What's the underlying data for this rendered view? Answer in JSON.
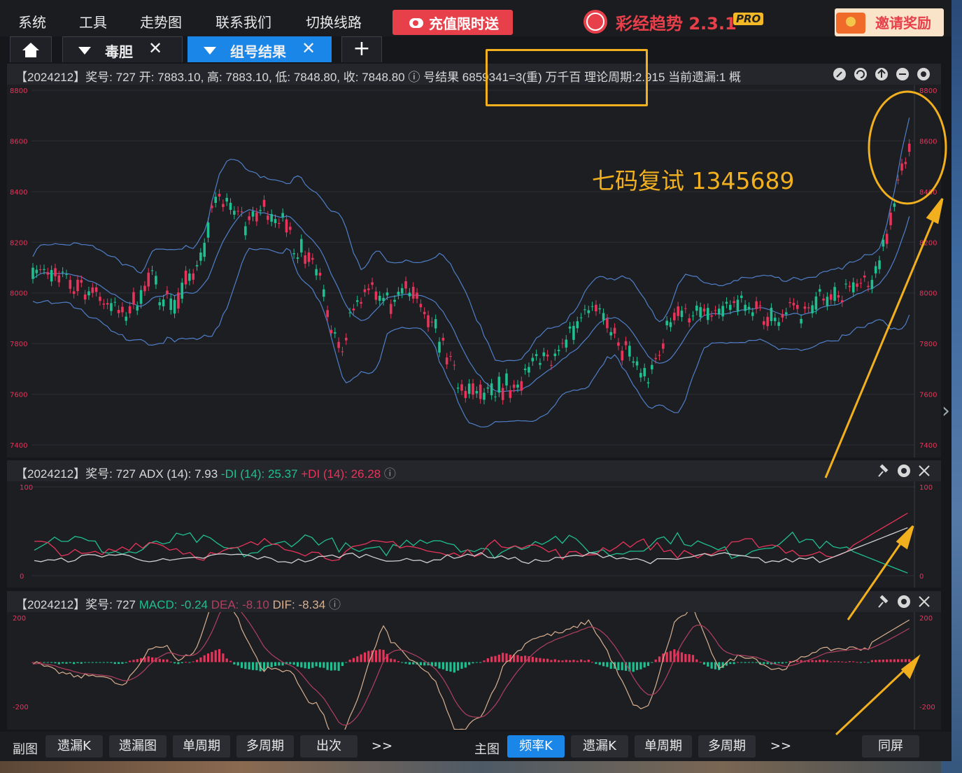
{
  "menu": [
    "系统",
    "工具",
    "走势图",
    "联系我们",
    "切换线路"
  ],
  "promo": "充值限时送",
  "brand": {
    "name": "彩经趋势 2.3.1",
    "pro": "PRO"
  },
  "invite": "邀请奖励",
  "tabs": [
    {
      "label": "毒胆",
      "close": "✕"
    },
    {
      "label": "组号结果",
      "close": "✕"
    }
  ],
  "main_header": {
    "info": "【2024212】奖号: 727  开: 7883.10, 高: 7883.10, 低: 7848.80, 收: 7848.80  ⓘ 号结果  6859341=3(重)  万千百  理论周期:2.915  当前遗漏:1  概"
  },
  "adx_header": {
    "prefix": "【2024212】奖号: 727  ADX (14): 7.93",
    "minus_di": "-DI (14): 25.37",
    "plus_di": "+DI (14): 26.28"
  },
  "macd_header": {
    "prefix": "【2024212】奖号: 727",
    "macd": "MACD: -0.24",
    "dea": "DEA: -8.10",
    "dif": "DIF: -8.34"
  },
  "annotation": "七码复试  1345689",
  "bottom": {
    "sub_label": "副图",
    "sub_buttons": [
      "遗漏K",
      "遗漏图",
      "单周期",
      "多周期",
      "出次"
    ],
    "main_label": "主图",
    "main_buttons": [
      "频率K",
      "遗漏K",
      "单周期",
      "多周期"
    ],
    "more": ">>",
    "sync": "同屏"
  },
  "colors": {
    "up": "#e8345a",
    "down": "#1fbf8f",
    "band": "#4f7fc8",
    "accent": "#f2b01e",
    "tab_active": "#1a86e8"
  },
  "chart_data": [
    {
      "type": "candlestick",
      "title": "频率K",
      "y_ticks": [
        8800,
        8600,
        8400,
        8200,
        8000,
        7800,
        7600,
        7400
      ],
      "ylim": [
        7400,
        8800
      ],
      "indicators": [
        "Bollinger bands"
      ],
      "last": {
        "open": 7883.1,
        "high": 7883.1,
        "low": 7848.8,
        "close": 7848.8
      }
    },
    {
      "type": "line",
      "title": "ADX",
      "y_ticks": [
        100,
        0
      ],
      "ylim": [
        0,
        100
      ],
      "series": [
        {
          "name": "ADX (14)",
          "last": 7.93
        },
        {
          "name": "-DI (14)",
          "last": 25.37
        },
        {
          "name": "+DI (14)",
          "last": 26.28
        }
      ]
    },
    {
      "type": "bar",
      "title": "MACD",
      "y_ticks": [
        200,
        -200
      ],
      "ylim": [
        -200,
        200
      ],
      "series": [
        {
          "name": "MACD",
          "last": -0.24
        },
        {
          "name": "DEA",
          "last": -8.1
        },
        {
          "name": "DIF",
          "last": -8.34
        }
      ]
    }
  ]
}
